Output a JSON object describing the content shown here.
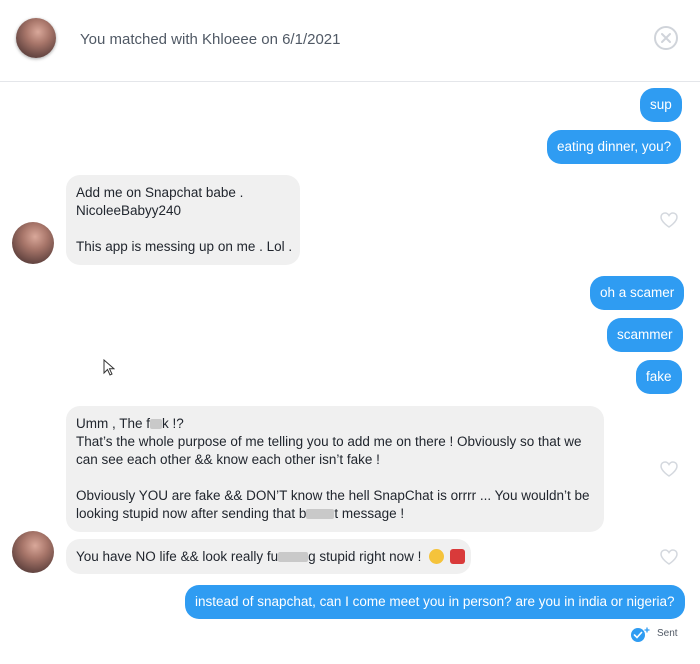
{
  "header": {
    "title": "You matched with Khloeee on 6/1/2021"
  },
  "messages": {
    "m1": "sup",
    "m2": "eating dinner, you?",
    "m3_line1": "Add me on Snapchat babe .",
    "m3_line2": "NicoleeBabyy240",
    "m3_line3": "This app is messing up on me . Lol .",
    "m4": "oh a scamer",
    "m5": "scammer",
    "m6": "fake",
    "m7_line1_a": "Umm , The f",
    "m7_line1_b": "k !?",
    "m7_line2": "That’s the whole purpose of me telling you to add me on there ! Obviously so that we",
    "m7_line3": "can see each other && know each other isn’t fake !",
    "m7_line4": "Obviously YOU are fake && DON’T know the hell SnapChat is orrrr ... You wouldn’t be",
    "m7_line5_a": "looking stupid now after sending that b",
    "m7_line5_b": "t message !",
    "m8_a": "You have NO life && look really fu",
    "m8_b": "g stupid right now !",
    "m9": "instead of snapchat, can I come meet you in person? are you in india or nigeria?"
  },
  "status": {
    "sent_label": "Sent"
  },
  "icons": {
    "close": "close-icon",
    "heart": "heart-icon",
    "sent": "sent-check-icon",
    "cursor": "mouse-cursor-icon"
  },
  "colors": {
    "sent_bubble": "#2f9cf2",
    "received_bubble": "#f0f0f0",
    "heart_outline": "#d4d8de"
  }
}
